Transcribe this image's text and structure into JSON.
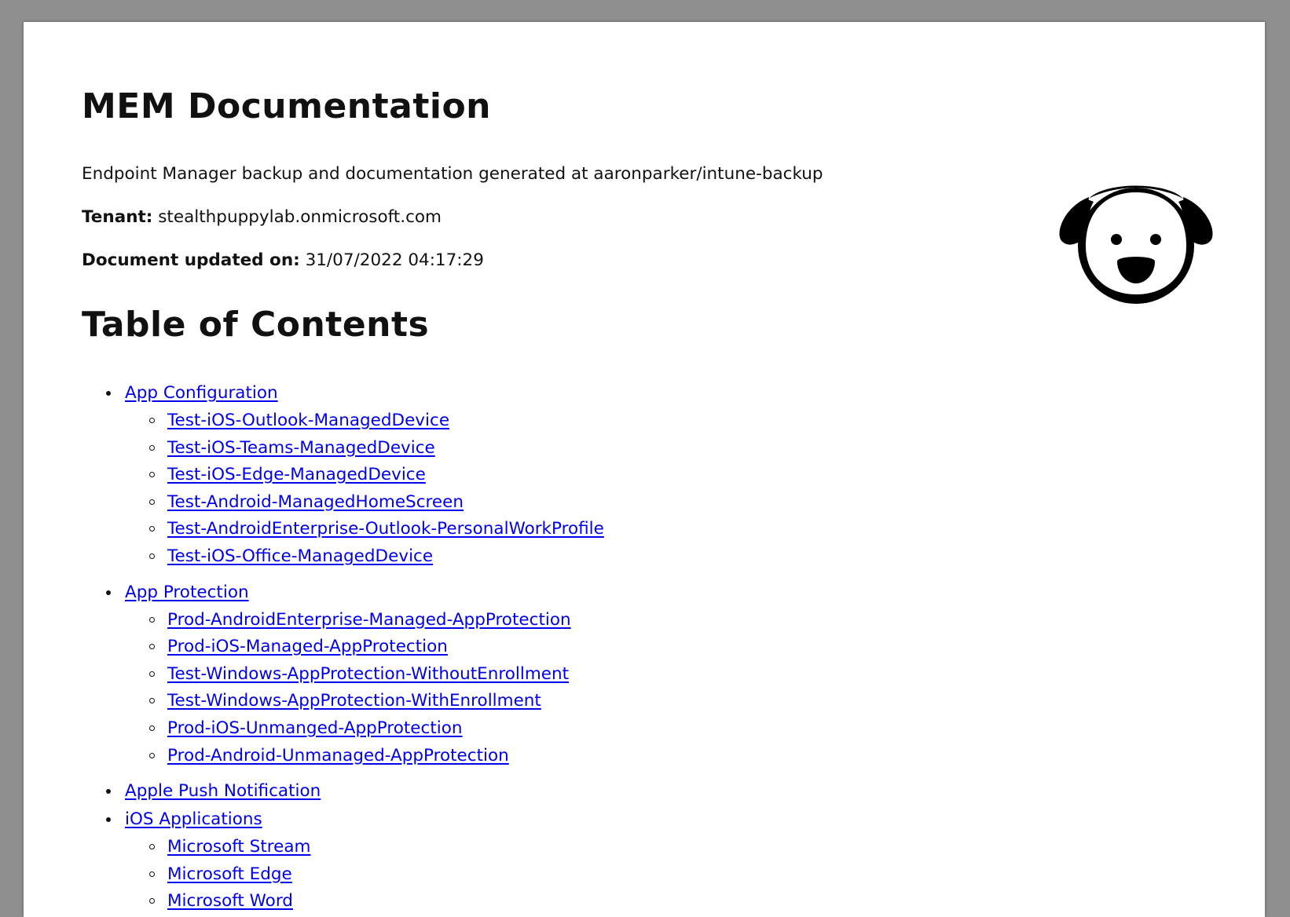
{
  "header": {
    "title": "MEM Documentation",
    "subtitle": "Endpoint Manager backup and documentation generated at aaronparker/intune-backup",
    "tenant_label": "Tenant:",
    "tenant_value": "stealthpuppylab.onmicrosoft.com",
    "updated_label": "Document updated on:",
    "updated_value": "31/07/2022 04:17:29"
  },
  "toc": {
    "title": "Table of Contents",
    "sections": [
      {
        "label": "App Configuration",
        "children": [
          "Test-iOS-Outlook-ManagedDevice",
          "Test-iOS-Teams-ManagedDevice",
          "Test-iOS-Edge-ManagedDevice",
          "Test-Android-ManagedHomeScreen",
          "Test-AndroidEnterprise-Outlook-PersonalWorkProfile",
          "Test-iOS-Office-ManagedDevice"
        ]
      },
      {
        "label": "App Protection",
        "children": [
          "Prod-AndroidEnterprise-Managed-AppProtection",
          "Prod-iOS-Managed-AppProtection",
          "Test-Windows-AppProtection-WithoutEnrollment",
          "Test-Windows-AppProtection-WithEnrollment",
          "Prod-iOS-Unmanged-AppProtection",
          "Prod-Android-Unmanaged-AppProtection"
        ]
      },
      {
        "label": "Apple Push Notification",
        "children": []
      },
      {
        "label": "iOS Applications",
        "children": [
          "Microsoft Stream",
          "Microsoft Edge",
          "Microsoft Word"
        ]
      }
    ]
  },
  "logo": {
    "icon": "puppy-face-icon"
  },
  "colors": {
    "link": "#0000ee",
    "text": "#111111",
    "backdrop": "#8f8f8f"
  }
}
